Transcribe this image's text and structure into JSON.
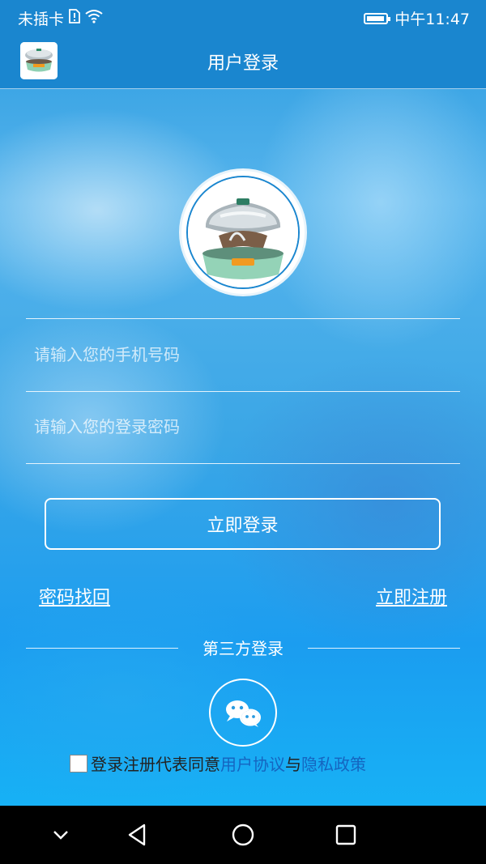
{
  "status_bar": {
    "carrier": "未插卡",
    "time": "中午11:47",
    "battery_level": 0.8
  },
  "header": {
    "title": "用户登录"
  },
  "form": {
    "phone_placeholder": "请输入您的手机号码",
    "password_placeholder": "请输入您的登录密码",
    "login_button": "立即登录"
  },
  "links": {
    "forgot_password": "密码找回",
    "register": "立即注册"
  },
  "third_party": {
    "label": "第三方登录",
    "wechat_icon": "wechat-icon"
  },
  "agreement": {
    "prefix": "登录注册代表同意 ",
    "terms": "用户协议",
    "conjunction": "与",
    "privacy": "隐私政策"
  },
  "colors": {
    "header": "#1a86cf",
    "link_blue": "#1565c0"
  }
}
